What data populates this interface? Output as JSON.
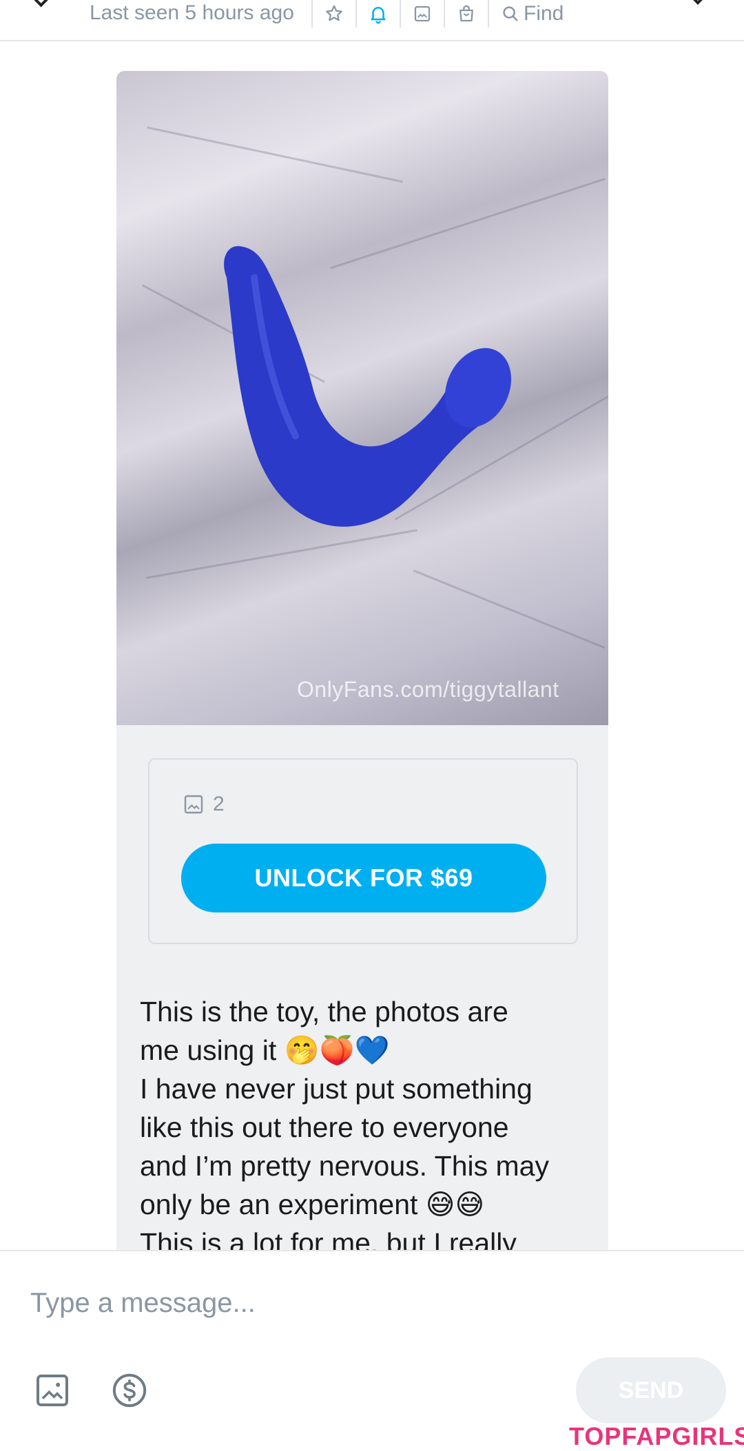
{
  "header": {
    "status": "Last seen 5 hours ago",
    "find_label": "Find",
    "icons": [
      "back-chevron-icon",
      "star-icon",
      "bell-icon",
      "image-icon",
      "shop-bag-icon",
      "search-icon",
      "more-chevron-icon"
    ],
    "active_color": "#00aff0"
  },
  "message": {
    "photo_watermark": "OnlyFans.com/tiggytallant",
    "media_count": "2",
    "unlock_label": "UNLOCK FOR $69",
    "text": "This is the toy, the photos are\nme using it 🤭🍑💙\nI have never just put something\nlike this out there to everyone\nand I’m pretty nervous. This may\nonly be an experiment 😅😅\nThis is a lot for me, but I really"
  },
  "composer": {
    "placeholder": "Type a message...",
    "send_label": "SEND",
    "icons": [
      "image-attach-icon",
      "dollar-tip-icon"
    ]
  },
  "watermark": {
    "text": "TOPFAPGIRLS"
  },
  "colors": {
    "accent": "#00aff0",
    "muted": "#8a96a3",
    "bubble": "#eef0f1",
    "toy": "#2b3ac9",
    "watermark": "#e8347a"
  }
}
